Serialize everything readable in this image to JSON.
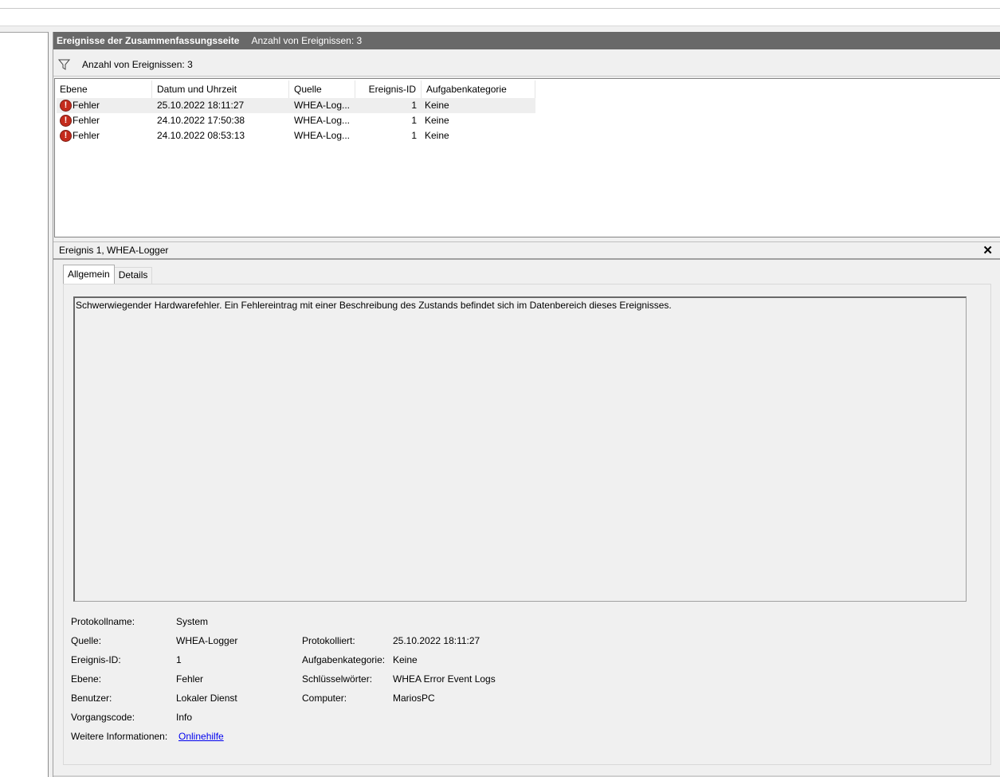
{
  "header": {
    "title": "Ereignisse der Zusammenfassungsseite",
    "count": "Anzahl von Ereignissen: 3"
  },
  "filter": {
    "icon": "filter-icon",
    "text": "Anzahl von Ereignissen: 3"
  },
  "table": {
    "columns": [
      "Ebene",
      "Datum und Uhrzeit",
      "Quelle",
      "Ereignis-ID",
      "Aufgabenkategorie"
    ],
    "rows": [
      {
        "level": "Fehler",
        "datetime": "25.10.2022 18:11:27",
        "source": "WHEA-Log...",
        "id": "1",
        "category": "Keine",
        "selected": true
      },
      {
        "level": "Fehler",
        "datetime": "24.10.2022 17:50:38",
        "source": "WHEA-Log...",
        "id": "1",
        "category": "Keine",
        "selected": false
      },
      {
        "level": "Fehler",
        "datetime": "24.10.2022 08:53:13",
        "source": "WHEA-Log...",
        "id": "1",
        "category": "Keine",
        "selected": false
      }
    ],
    "level_icon": "error-icon",
    "error_color": "#c42b1c"
  },
  "detail": {
    "title": "Ereignis 1, WHEA-Logger",
    "close_icon": "close-icon",
    "tabs": [
      "Allgemein",
      "Details"
    ],
    "active_tab": "Allgemein",
    "description": "Schwerwiegender Hardwarefehler. Ein Fehlereintrag mit einer Beschreibung des Zustands befindet sich im Datenbereich dieses Ereignisses.",
    "fields": {
      "protokollname_label": "Protokollname:",
      "protokollname_value": "System",
      "quelle_label": "Quelle:",
      "quelle_value": "WHEA-Logger",
      "protokolliert_label": "Protokolliert:",
      "protokolliert_value": "25.10.2022 18:11:27",
      "ereignis_id_label": "Ereignis-ID:",
      "ereignis_id_value": "1",
      "aufgabenkategorie_label": "Aufgabenkategorie:",
      "aufgabenkategorie_value": "Keine",
      "ebene_label": "Ebene:",
      "ebene_value": "Fehler",
      "schluesselwoerter_label": "Schlüsselwörter:",
      "schluesselwoerter_value": "WHEA Error Event Logs",
      "benutzer_label": "Benutzer:",
      "benutzer_value": "Lokaler Dienst",
      "computer_label": "Computer:",
      "computer_value": "MariosPC",
      "vorgangscode_label": "Vorgangscode:",
      "vorgangscode_value": "Info",
      "weitere_label": "Weitere Informationen:",
      "weitere_link": "Onlinehilfe"
    }
  },
  "colors": {
    "header_bg": "#696969",
    "panel_bg": "#f0f0f0",
    "link": "#0000ee"
  }
}
